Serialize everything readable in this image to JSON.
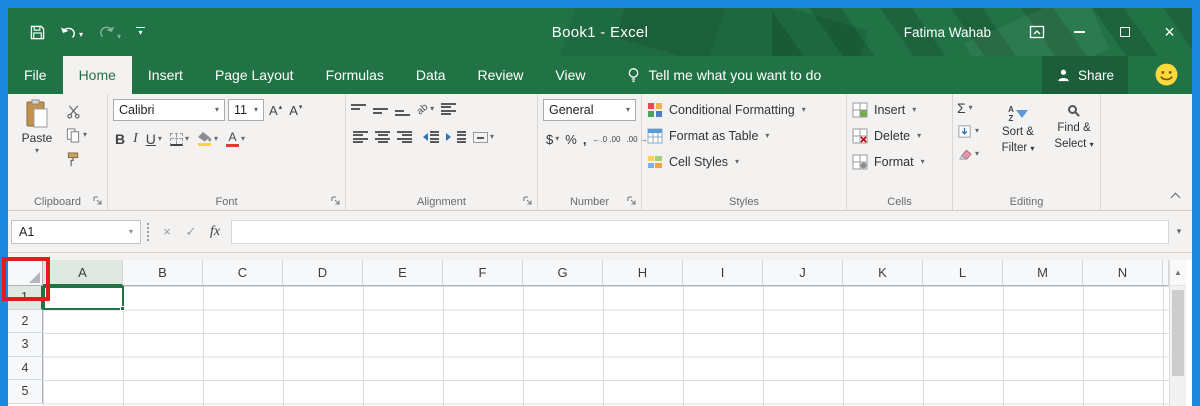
{
  "colors": {
    "excel_green": "#217346",
    "ribbon_bg": "#f3f2f1",
    "desktop_blue": "#1b87dd",
    "annotation_red": "#e8191c",
    "header_selected_bg": "#e0e8e2",
    "grid_line": "#d8dde3"
  },
  "window": {
    "title": "Book1 - Excel",
    "user_name": "Fatima Wahab"
  },
  "tabs": {
    "items": [
      "File",
      "Home",
      "Insert",
      "Page Layout",
      "Formulas",
      "Data",
      "Review",
      "View"
    ],
    "active": "Home",
    "tell_me": "Tell me what you want to do",
    "share": "Share"
  },
  "ribbon": {
    "clipboard": {
      "label": "Clipboard",
      "paste": "Paste"
    },
    "font": {
      "label": "Font",
      "name": "Calibri",
      "size": "11",
      "bold": "B",
      "italic": "I",
      "underline": "U",
      "grow": "A",
      "shrink": "A",
      "color_letter": "A"
    },
    "alignment": {
      "label": "Alignment",
      "orientation_glyph": "ab"
    },
    "number": {
      "label": "Number",
      "format": "General",
      "currency": "$",
      "percent": "%",
      "comma": ",",
      "inc_decimal": "←.0 .00",
      "dec_decimal": ".00 →.0"
    },
    "styles": {
      "label": "Styles",
      "conditional_formatting": "Conditional Formatting",
      "format_as_table": "Format as Table",
      "cell_styles": "Cell Styles"
    },
    "cells": {
      "label": "Cells",
      "insert": "Insert",
      "delete": "Delete",
      "format": "Format"
    },
    "editing": {
      "label": "Editing",
      "autosum": "Σ",
      "az_a": "A",
      "az_z": "Z",
      "sort_line1": "Sort &",
      "sort_line2": "Filter",
      "find_line1": "Find &",
      "find_line2": "Select"
    }
  },
  "formula_bar": {
    "name_box": "A1",
    "fx": "fx",
    "formula": ""
  },
  "sheet": {
    "columns": [
      "A",
      "B",
      "C",
      "D",
      "E",
      "F",
      "G",
      "H",
      "I",
      "J",
      "K",
      "L",
      "M",
      "N"
    ],
    "rows": [
      "1",
      "2",
      "3",
      "4",
      "5"
    ],
    "active_cell": "A1"
  },
  "glyphs": {
    "caret": "▾",
    "caret_up": "▴",
    "scroll_up": "▲",
    "check": "✓",
    "cancel": "×",
    "close": "×"
  }
}
